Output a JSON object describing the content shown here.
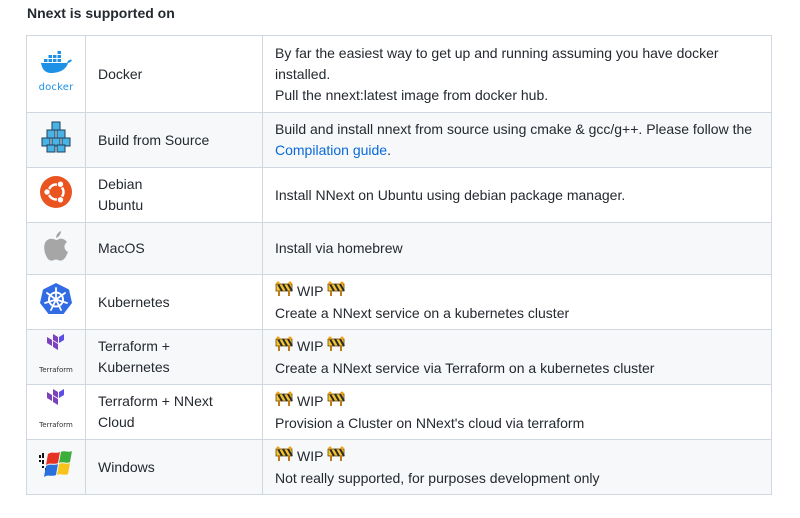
{
  "heading": "Nnext is supported on",
  "rows": [
    {
      "icon": "docker-icon",
      "icon_label": "docker",
      "name": [
        "Docker"
      ],
      "desc": [
        "By far the easiest way to get up and running assuming you have docker",
        "installed.",
        "Pull the nnext:latest image from docker hub."
      ]
    },
    {
      "icon": "build-from-source-cubes-icon",
      "name": [
        "Build from Source"
      ],
      "desc": [
        "Build and install nnext from source using cmake & gcc/g++. Please follow the"
      ],
      "link_text": "Compilation guide",
      "link_suffix": "."
    },
    {
      "icon": "ubuntu-icon",
      "name": [
        "Debian",
        "Ubuntu"
      ],
      "desc": [
        "Install NNext on Ubuntu using debian package manager."
      ]
    },
    {
      "icon": "apple-icon",
      "name": [
        "MacOS"
      ],
      "desc": [
        "Install via homebrew"
      ]
    },
    {
      "icon": "kubernetes-icon",
      "name": [
        "Kubernetes"
      ],
      "wip": "WIP",
      "desc": [
        "Create a NNext service on a kubernetes cluster"
      ]
    },
    {
      "icon": "terraform-icon",
      "icon_label": "Terraform",
      "name": [
        "Terraform +",
        "Kubernetes"
      ],
      "wip": "WIP",
      "desc": [
        "Create a NNext service via Terraform on a kubernetes cluster"
      ]
    },
    {
      "icon": "terraform-icon",
      "icon_label": "Terraform",
      "name": [
        "Terraform + NNext",
        "Cloud"
      ],
      "wip": "WIP",
      "desc": [
        "Provision a Cluster on NNext's cloud via terraform"
      ]
    },
    {
      "icon": "windows-icon",
      "name": [
        "Windows"
      ],
      "wip": "WIP",
      "desc": [
        "Not really supported, for purposes development only"
      ]
    }
  ],
  "colors": {
    "link": "#0969da",
    "border": "#d0d7de",
    "alt_row_bg": "#f6f8fa",
    "docker_blue": "#1d91e6",
    "ubuntu_orange": "#e95420",
    "kubernetes_blue": "#326ce5",
    "terraform_purple": "#7b42bc"
  }
}
